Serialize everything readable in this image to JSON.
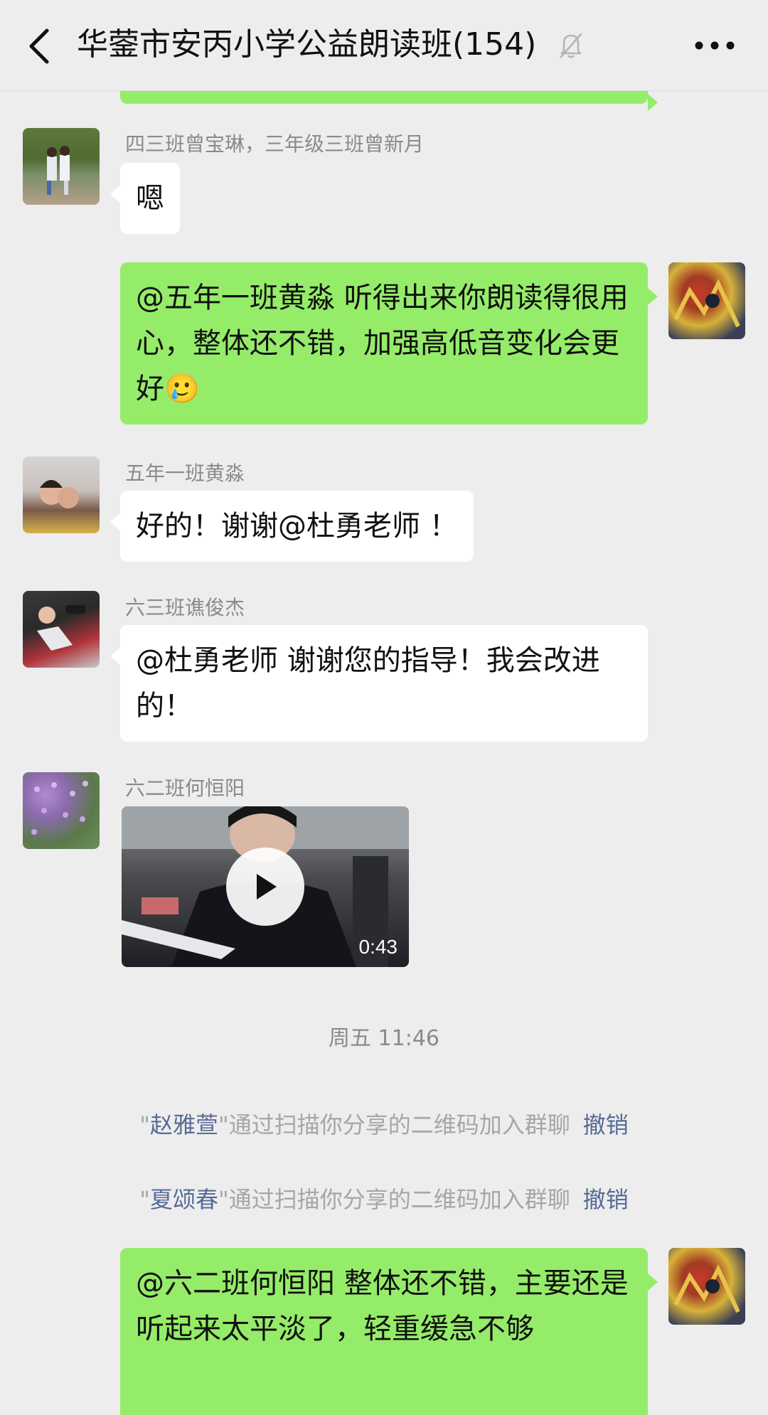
{
  "header": {
    "title": "华蓥市安丙小学公益朗读班(154)",
    "back_icon": "chevron-left-icon",
    "mute_icon": "bell-off-icon",
    "more_icon": "more-dots-icon"
  },
  "messages": [
    {
      "sender": "四三班曾宝琳，三年级三班曾新月",
      "text": "嗯"
    },
    {
      "text": "@五年一班黄淼  听得出来你朗读得很用心，整体还不错，加强高低音变化会更好",
      "emoji": "🥲"
    },
    {
      "sender": "五年一班黄淼",
      "text": "好的！谢谢@杜勇老师 ！"
    },
    {
      "sender": "六三班谯俊杰",
      "text": "@杜勇老师  谢谢您的指导！我会改进的！"
    },
    {
      "sender": "六二班何恒阳",
      "video_duration": "0:43",
      "play_icon": "play-icon"
    },
    {
      "text": "@六二班何恒阳  整体还不错，主要还是听起来太平淡了，轻重缓急不够"
    }
  ],
  "timestamp": "周五 11:46",
  "system_notices": [
    {
      "quote_open": "\"",
      "name": "赵雅萱",
      "quote_close": "\"",
      "text": "通过扫描你分享的二维码加入群聊",
      "action": "撤销"
    },
    {
      "quote_open": "\"",
      "name": "夏颂春",
      "quote_close": "\"",
      "text": "通过扫描你分享的二维码加入群聊",
      "action": "撤销"
    }
  ],
  "colors": {
    "background": "#ededed",
    "self_bubble": "#95ec69",
    "other_bubble": "#ffffff",
    "link": "#576b95"
  }
}
